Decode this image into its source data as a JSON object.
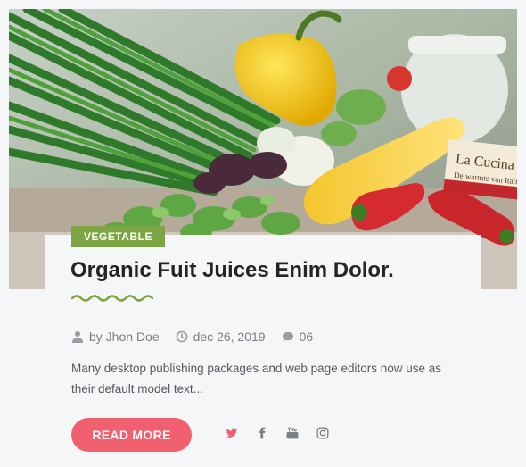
{
  "post": {
    "category": "VEGETABLE",
    "title": "Organic Fuit Juices Enim Dolor.",
    "author": "by Jhon Doe",
    "date": "dec 26, 2019",
    "comments": "06",
    "excerpt": "Many desktop publishing packages and web page editors now use as their default model text...",
    "read_more_label": "READ MORE"
  },
  "image": {
    "book_title": "La Cucina",
    "book_subtitle": "De warmte van Italië"
  },
  "social": [
    {
      "icon": "twitter-icon",
      "color": "#f0606e"
    },
    {
      "icon": "facebook-icon",
      "color": "#7a7f86"
    },
    {
      "icon": "youtube-icon",
      "color": "#7a7f86"
    },
    {
      "icon": "instagram-icon",
      "color": "#7a7f86"
    }
  ],
  "colors": {
    "accent": "#f0606e",
    "badge": "#7da544",
    "background": "#f5f6f8"
  }
}
